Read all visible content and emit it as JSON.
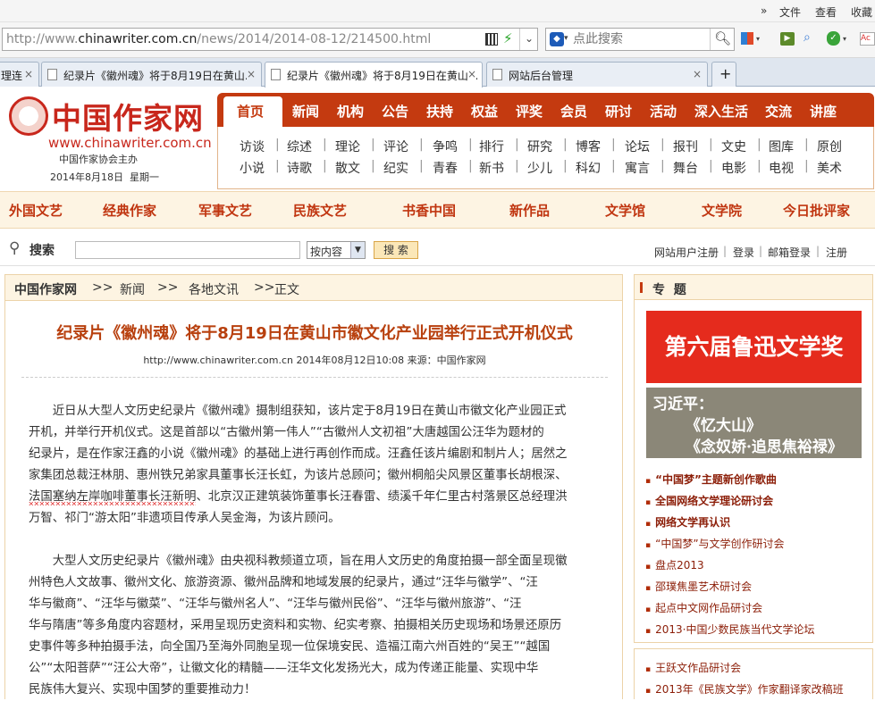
{
  "browser": {
    "menu": {
      "more": "»",
      "file": "文件",
      "view": "查看",
      "favorites": "收藏"
    },
    "url_prefix": "http://www.",
    "url_domain": "chinawriter.com.cn",
    "url_path": "/news/2014/2014-08-12/214500.html",
    "search_placeholder": "点此搜索",
    "tabs": [
      {
        "label": "理连"
      },
      {
        "label": "纪录片《徽州魂》将于8月19日在黄山..."
      },
      {
        "label": "纪录片《徽州魂》将于8月19日在黄山..."
      },
      {
        "label": "网站后台管理"
      }
    ],
    "new_tab": "+",
    "close": "×"
  },
  "site": {
    "logo_text": "中国作家网",
    "logo_url": "www.chinawriter.com.cn",
    "logo_sub": "中国作家协会主办",
    "date": "2014年8月18日  星期一",
    "nav_main": [
      "首页",
      "新闻",
      "机构",
      "公告",
      "扶持",
      "权益",
      "评奖",
      "会员",
      "研讨",
      "活动",
      "深入生活",
      "交流",
      "讲座"
    ],
    "nav_sub_row1": [
      "访谈",
      "综述",
      "理论",
      "评论",
      "争鸣",
      "排行",
      "研究",
      "博客",
      "论坛",
      "报刊",
      "文史",
      "图库",
      "原创"
    ],
    "nav_sub_row2": [
      "小说",
      "诗歌",
      "散文",
      "纪实",
      "青春",
      "新书",
      "少儿",
      "科幻",
      "寓言",
      "舞台",
      "电影",
      "电视",
      "美术"
    ],
    "band": [
      "外国文艺",
      "经典作家",
      "军事文艺",
      "民族文艺",
      "书香中国",
      "新作品",
      "文学馆",
      "文学院",
      "今日批评家"
    ],
    "search_label": "搜索",
    "search_select": "按内容",
    "search_button": "搜 索",
    "user_links": [
      "网站用户注册",
      "登录",
      "邮箱登录",
      "注册"
    ]
  },
  "breadcrumb": [
    "中国作家网",
    ">>",
    "新闻",
    ">>",
    "各地文讯",
    ">>",
    "正文"
  ],
  "article": {
    "title": "纪录片《徽州魂》将于8月19日在黄山市徽文化产业园举行正式开机仪式",
    "meta": "http://www.chinawriter.com.cn 2014年08月12日10:08 来源：中国作家网",
    "p1_lines": [
      "近日从大型人文历史纪录片《徽州魂》摄制组获知，该片定于8月19日在黄山市徽文化产业园正式",
      "开机，并举行开机仪式。这是首部以“古徽州第一伟人”“古徽州人文初祖”大唐越国公汪华为题材的",
      "纪录片，是在作家汪鑫的小说《徽州魂》的基础上进行再创作而成。汪鑫任该片编剧和制片人；居然之",
      "家集团总裁汪林朋、惠州铁兄弟家具董事长汪长虹，为该片总顾问；徽州桐船尖风景区董事长胡根深、"
    ],
    "p1_underlined": "法国塞纳左岸咖啡董事长汪新明",
    "p1_line5_rest": "、北京汉正建筑装饰董事长汪春雷、绩溪千年仁里古村落景区总经理洪",
    "p1_last": "万智、祁门“游太阳”非遗项目传承人吴金海，为该片顾问。",
    "p2_lines": [
      "大型人文历史纪录片《徽州魂》由央视科教频道立项，旨在用人文历史的角度拍摄一部全面呈现徽",
      "州特色人文故事、徽州文化、旅游资源、徽州品牌和地域发展的纪录片，通过“汪华与徽学”、“汪",
      "华与徽商”、“汪华与徽菜”、“汪华与徽州名人”、“汪华与徽州民俗”、“汪华与徽州旅游”、“汪",
      "华与隋唐”等多角度内容题材，采用呈现历史资料和实物、纪实考察、拍摄相关历史现场和场景还原历",
      "史事件等多种拍摄手法，向全国乃至海外同胞呈现一位保境安民、造福江南六州百姓的“吴王”“越国",
      "公”“太阳菩萨”“汪公大帝”，让徽文化的精髓——汪华文化发扬光大，成为传递正能量、实现中华",
      "民族伟大复兴、实现中国梦的重要推动力！"
    ]
  },
  "sidebar": {
    "heading": "专  题",
    "banner1": "第六届鲁迅文学奖",
    "banner2_name": "习近平：",
    "banner2_line1": "《忆大山》",
    "banner2_line2": "《念奴娇·追思焦裕禄》",
    "links": [
      {
        "text": "“中国梦”主题新创作歌曲",
        "bold": true
      },
      {
        "text": "全国网络文学理论研讨会",
        "bold": true
      },
      {
        "text": "网络文学再认识",
        "bold": true
      },
      {
        "text": "“中国梦”与文学创作研讨会",
        "bold": false
      },
      {
        "text": "盘点2013",
        "bold": false
      },
      {
        "text": "邵璞焦墨艺术研讨会",
        "bold": false
      },
      {
        "text": "起点中文网作品研讨会",
        "bold": false
      },
      {
        "text": "2013·中国少数民族当代文学论坛",
        "bold": false
      }
    ],
    "links2": [
      "王跃文作品研讨会",
      "2013年《民族文学》作家翻译家改稿班"
    ]
  },
  "colors": {
    "brand_red": "#c43a10",
    "title_orange": "#b8400e",
    "link_red": "#8c1e08"
  }
}
